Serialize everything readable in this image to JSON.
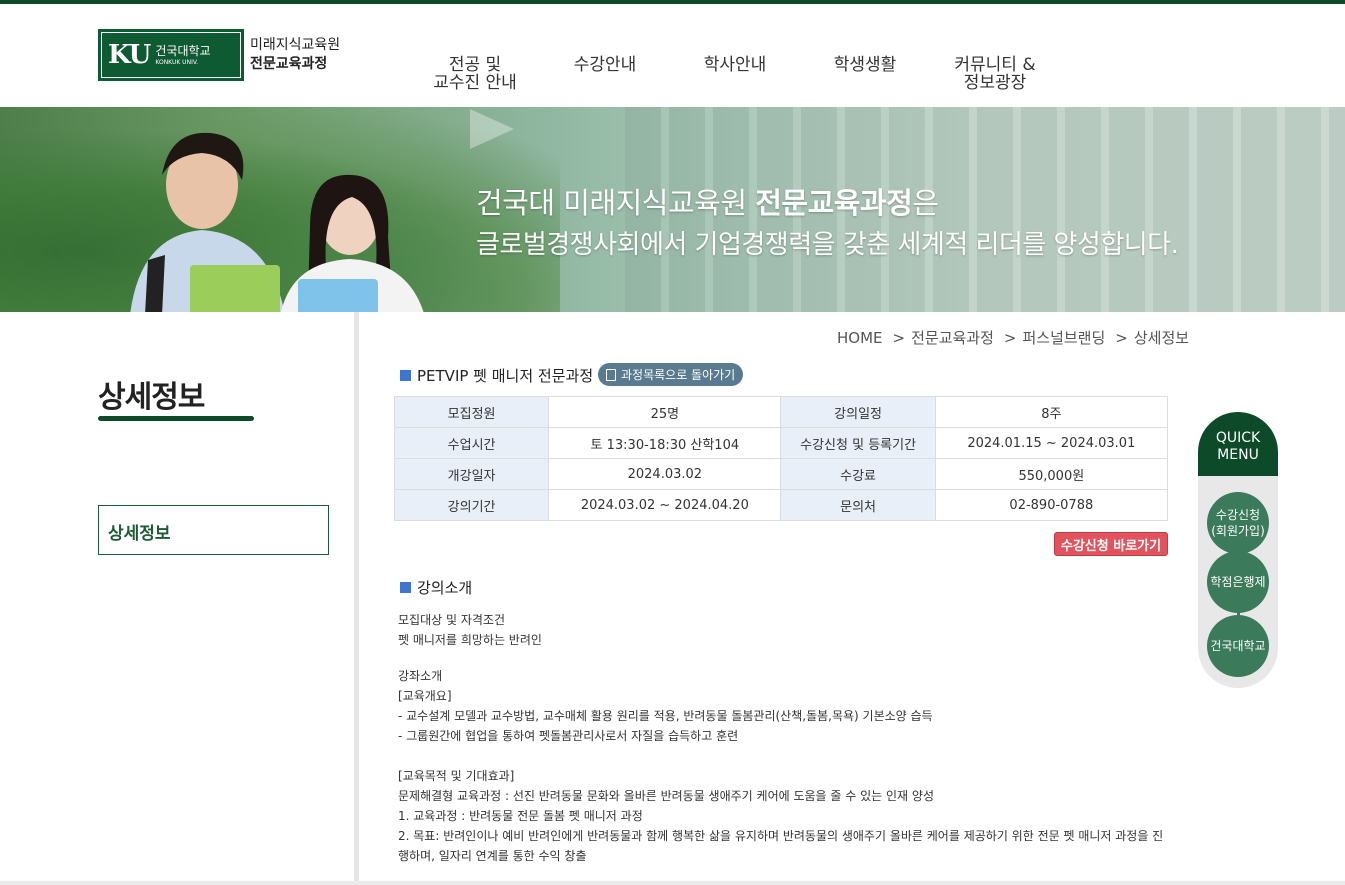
{
  "header": {
    "logo_ku": "KU",
    "logo_kr": "건국대학교",
    "logo_en": "KONKUK UNIV.",
    "org_line1": "미래지식교육원",
    "org_line2": "전문교육과정",
    "nav": [
      "전공 및\n교수진 안내",
      "수강안내",
      "학사안내",
      "학생생활",
      "커뮤니티 &\n정보광장"
    ]
  },
  "banner": {
    "slogan1_pre": "건국대 미래지식교육원 ",
    "slogan1_bold": "전문교육과정",
    "slogan1_post": "은",
    "slogan2": "글로벌경쟁사회에서 기업경쟁력을 갖춘 세계적 리더를 양성합니다."
  },
  "sidebar": {
    "title": "상세정보",
    "menu_item": "상세정보"
  },
  "breadcrumb": [
    "HOME",
    "전문교육과정",
    "퍼스널브랜딩",
    "상세정보"
  ],
  "course": {
    "title": "PETVIP 펫 매니저 전문과정",
    "back_label": "과정목록으로 돌아가기",
    "rows": [
      [
        "모집정원",
        "25명",
        "강의일정",
        "8주"
      ],
      [
        "수업시간",
        "토 13:30-18:30 산학104",
        "수강신청 및 등록기간",
        "2024.01.15 ~ 2024.03.01"
      ],
      [
        "개강일자",
        "2024.03.02",
        "수강료",
        "550,000원"
      ],
      [
        "강의기간",
        "2024.03.02 ~ 2024.04.20",
        "문의처",
        "02-890-0788"
      ]
    ],
    "apply_label": "수강신청 바로가기"
  },
  "intro": {
    "title": "강의소개",
    "lines1": [
      "모집대상 및 자격조건",
      "펫 매니저를 희망하는 반려인"
    ],
    "lines2": [
      "강좌소개",
      "[교육개요]",
      "- 교수설계 모델과 교수방법, 교수매체 활용 원리를 적용, 반려동물 돌봄관리(산책,돌봄,목욕) 기본소양 습득",
      "- 그룹원간에 협업을 통하여 펫돌봄관리사로서 자질을 습득하고 훈련"
    ],
    "lines3": [
      "[교육목적 및 기대효과]",
      "문제해결형 교육과정 : 선진 반려동물 문화와 올바른 반려동물 생애주기 케어에 도움을 줄 수 있는 인재 양성",
      "1. 교육과정 : 반려동물 전문 돌봄 펫 매니저 과정",
      "2. 목표: 반려인이나 예비 반려인에게 반려동물과 함께 행복한 삶을 유지하며 반려동물의 생애주기 올바른 케어를 제공하기 위한 전문 펫 매니저 과정을 진",
      "행하며, 일자리 연계를 통한 수익 창출"
    ]
  },
  "quick": {
    "head": "QUICK\nMENU",
    "items": [
      "수강신청\n(회원가입)",
      "학점은행제",
      "건국대학교"
    ]
  }
}
